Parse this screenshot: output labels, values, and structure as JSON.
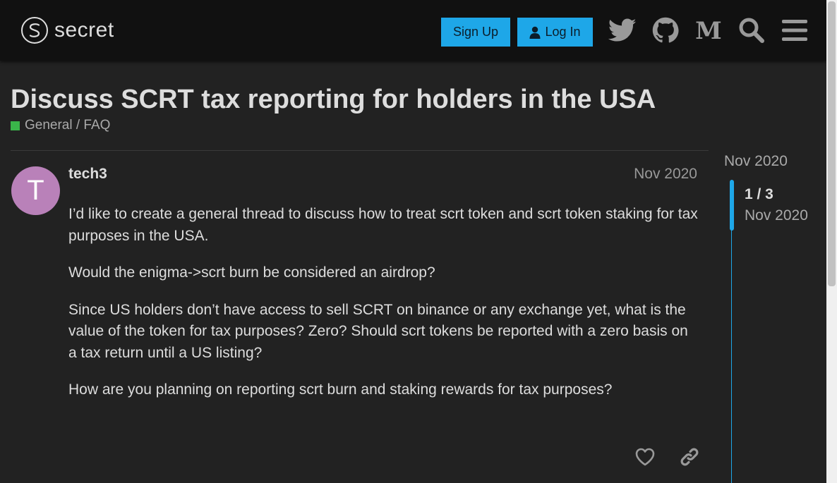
{
  "header": {
    "logo_text": "secret",
    "signup_label": "Sign Up",
    "login_label": "Log In",
    "icons": [
      "twitter-icon",
      "github-icon",
      "medium-icon",
      "search-icon",
      "menu-icon"
    ]
  },
  "topic": {
    "title": "Discuss SCRT tax reporting for holders in the USA",
    "category": "General / FAQ",
    "category_color": "#3ab54a"
  },
  "post": {
    "avatar_letter": "T",
    "avatar_color": "#b981b9",
    "username": "tech3",
    "date": "Nov 2020",
    "paragraphs": [
      "I’d like to create a general thread to discuss how to treat scrt token and scrt token staking for tax purposes in the USA.",
      "Would the enigma->scrt burn be considered an airdrop?",
      "Since US holders don’t have access to sell SCRT on binance or any exchange yet, what is the value of the token for tax purposes? Zero? Should scrt tokens be reported with a zero basis on a tax return until a US listing?",
      "How are you planning on reporting scrt burn and staking rewards for tax purposes?"
    ]
  },
  "timeline": {
    "top_date": "Nov 2020",
    "position": "1 / 3",
    "current_date": "Nov 2020"
  },
  "colors": {
    "accent": "#1ea7e8",
    "header_bg": "#111111",
    "page_bg": "#222222"
  }
}
